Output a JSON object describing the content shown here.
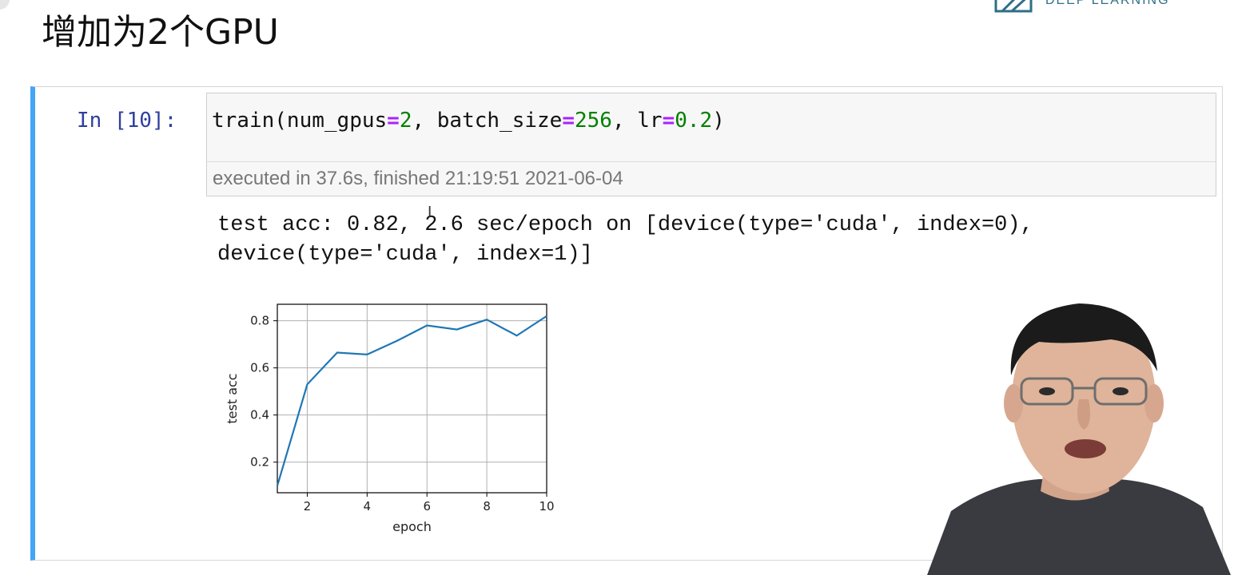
{
  "slide": {
    "title": "增加为2个GPU",
    "logo_text": "DEEP LEARNING"
  },
  "notebook": {
    "prompt": "In [10]:",
    "code": {
      "fn": "train(",
      "arg1_name": "num_gpus",
      "arg1_val": "2",
      "sep1": ", ",
      "arg2_name": "batch_size",
      "arg2_val": "256",
      "sep2": ", ",
      "arg3_name": "lr",
      "arg3_val": "0.2",
      "close": ")",
      "equals": "="
    },
    "execution": "executed in 37.6s, finished 21:19:51 2021-06-04",
    "output_line1": "test acc: 0.82, 2.6 sec/epoch on [device(type='cuda', index=0),",
    "output_line2": "device(type='cuda', index=1)]"
  },
  "chart_data": {
    "type": "line",
    "xlabel": "epoch",
    "ylabel": "test acc",
    "x": [
      1,
      2,
      3,
      4,
      5,
      6,
      7,
      8,
      9,
      10
    ],
    "series": [
      {
        "values": [
          0.1,
          0.53,
          0.665,
          0.657,
          0.715,
          0.78,
          0.763,
          0.805,
          0.737,
          0.82
        ]
      }
    ],
    "xlim": [
      1,
      10
    ],
    "ylim": [
      0.07,
      0.87
    ],
    "xticks": [
      2,
      4,
      6,
      8,
      10
    ],
    "yticks": [
      0.2,
      0.4,
      0.6,
      0.8
    ],
    "grid": true,
    "line_color": "#1f77b4"
  },
  "presenter": {
    "icon": "presenter-video"
  }
}
